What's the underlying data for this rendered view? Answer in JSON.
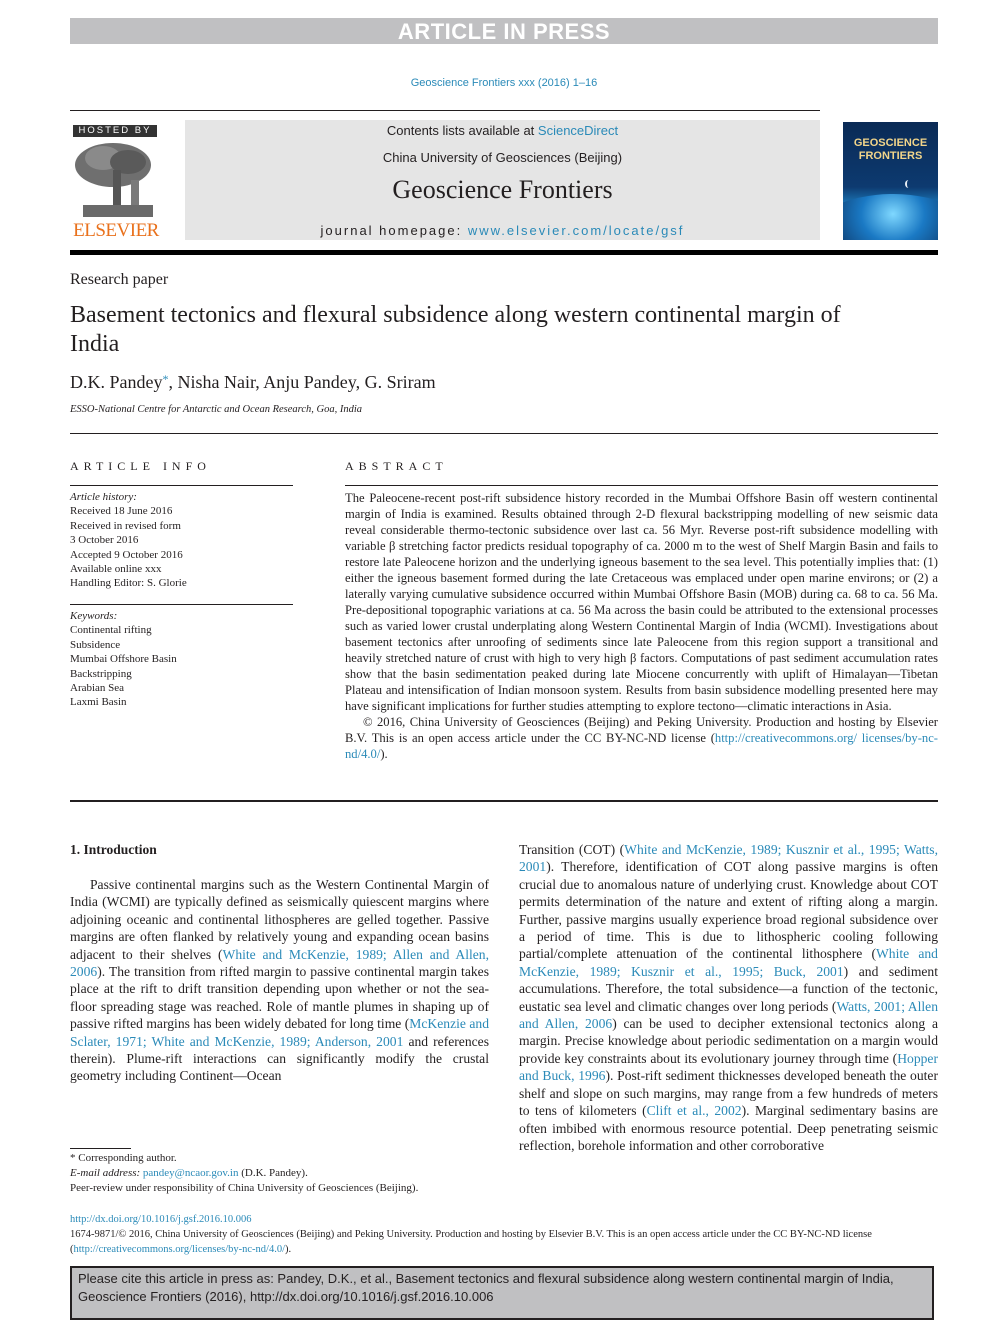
{
  "banner": {
    "text": "ARTICLE IN PRESS"
  },
  "journal_ref": "Geoscience Frontiers xxx (2016) 1–16",
  "publisher": {
    "hosted_by": "HOSTED BY",
    "logo_name": "ELSEVIER"
  },
  "masthead": {
    "contents_prefix": "Contents lists available at ",
    "contents_link": "ScienceDirect",
    "institution": "China University of Geosciences (Beijing)",
    "journal_title": "Geoscience Frontiers",
    "homepage_prefix": "journal homepage: ",
    "homepage_link": "www.elsevier.com/locate/gsf"
  },
  "cover": {
    "title_line1": "GEOSCIENCE",
    "title_line2": "FRONTIERS"
  },
  "article": {
    "type": "Research paper",
    "title": "Basement tectonics and flexural subsidence along western continental margin of India",
    "authors": [
      {
        "name": "D.K. Pandey",
        "mark": "*"
      },
      {
        "name": ", Nisha Nair, Anju Pandey, G. Sriram"
      }
    ],
    "affiliation": "ESSO-National Centre for Antarctic and Ocean Research, Goa, India"
  },
  "article_info": {
    "heading": "ARTICLE INFO",
    "history_label": "Article history:",
    "history": [
      "Received 18 June 2016",
      "Received in revised form",
      "3 October 2016",
      "Accepted 9 October 2016",
      "Available online xxx",
      "Handling Editor: S. Glorie"
    ],
    "keywords_label": "Keywords:",
    "keywords": [
      "Continental rifting",
      "Subsidence",
      "Mumbai Offshore Basin",
      "Backstripping",
      "Arabian Sea",
      "Laxmi Basin"
    ]
  },
  "abstract": {
    "heading": "ABSTRACT",
    "body": "The Paleocene-recent post-rift subsidence history recorded in the Mumbai Offshore Basin off western continental margin of India is examined. Results obtained through 2-D flexural backstripping modelling of new seismic data reveal considerable thermo-tectonic subsidence over last ca. 56 Myr. Reverse post-rift subsidence modelling with variable β stretching factor predicts residual topography of ca. 2000 m to the west of Shelf Margin Basin and fails to restore late Paleocene horizon and the underlying igneous basement to the sea level. This potentially implies that: (1) either the igneous basement formed during the late Cretaceous was emplaced under open marine environs; or (2) a laterally varying cumulative subsidence occurred within Mumbai Offshore Basin (MOB) during ca. 68 to ca. 56 Ma. Pre-depositional topographic variations at ca. 56 Ma across the basin could be attributed to the extensional processes such as varied lower crustal underplating along Western Continental Margin of India (WCMI). Investigations about basement tectonics after unroofing of sediments since late Paleocene from this region support a transitional and heavily stretched nature of crust with high to very high β factors. Computations of past sediment accumulation rates show that the basin sedimentation peaked during late Miocene concurrently with uplift of Himalayan—Tibetan Plateau and intensification of Indian monsoon system. Results from basin subsidence modelling presented here may have significant implications for further studies attempting to explore tectono—climatic interactions in Asia.",
    "copyright_text": "© 2016, China University of Geosciences (Beijing) and Peking University. Production and hosting by Elsevier B.V. This is an open access article under the CC BY-NC-ND license (",
    "license_link_1": "http://creativecommons.org/",
    "license_link_2": "licenses/by-nc-nd/4.0/",
    "copyright_end": ")."
  },
  "introduction": {
    "heading": "1.  Introduction",
    "left": [
      {
        "t": "Passive continental margins such as the Western Continental Margin of India (WCMI) are typically defined as seismically quiescent margins where adjoining oceanic and continental lithospheres are gelled together. Passive margins are often flanked by relatively young and expanding ocean basins adjacent to their shelves ("
      },
      {
        "l": "White and McKenzie, 1989; Allen and Allen, 2006"
      },
      {
        "t": "). The transition from rifted margin to passive continental margin takes place at the rift to drift transition depending upon whether or not the sea-floor spreading stage was reached. Role of mantle plumes in shaping up of passive rifted margins has been widely debated for long time ("
      },
      {
        "l": "McKenzie and Sclater, 1971; White and McKenzie, 1989; Anderson, 2001"
      },
      {
        "t": " and references therein). Plume-rift interactions can significantly modify the crustal geometry including Continent—Ocean"
      }
    ],
    "right": [
      {
        "t": "Transition (COT) ("
      },
      {
        "l": "White and McKenzie, 1989; Kusznir et al., 1995; Watts, 2001"
      },
      {
        "t": "). Therefore, identification of COT along passive margins is often crucial due to anomalous nature of underlying crust. Knowledge about COT permits determination of the nature and extent of rifting along a margin. Further, passive margins usually experience broad regional subsidence over a period of time. This is due to lithospheric cooling following partial/complete attenuation of the continental lithosphere ("
      },
      {
        "l": "White and McKenzie, 1989; Kusznir et al., 1995; Buck, 2001"
      },
      {
        "t": ") and sediment accumulations. Therefore, the total subsidence—a function of the tectonic, eustatic sea level and climatic changes over long periods ("
      },
      {
        "l": "Watts, 2001; Allen and Allen, 2006"
      },
      {
        "t": ") can be used to decipher extensional tectonics along a margin. Precise knowledge about periodic sedimentation on a margin would provide key constraints about its evolutionary journey through time ("
      },
      {
        "l": "Hopper and Buck, 1996"
      },
      {
        "t": "). Post-rift sediment thicknesses developed beneath the outer shelf and slope on such margins, may range from a few hundreds of meters to tens of kilometers ("
      },
      {
        "l": "Clift et al., 2002"
      },
      {
        "t": "). Marginal sedimentary basins are often imbibed with enormous resource potential. Deep penetrating seismic reflection, borehole information and other corroborative"
      }
    ]
  },
  "footnotes": {
    "corresponding": "* Corresponding author.",
    "email_label": "E-mail address: ",
    "email": "pandey@ncaor.gov.in",
    "email_suffix": " (D.K. Pandey).",
    "peer_review": "Peer-review under responsibility of China University of Geosciences (Beijing)."
  },
  "doi_block": {
    "doi_link": "http://dx.doi.org/10.1016/j.gsf.2016.10.006",
    "license_text": "1674-9871/© 2016, China University of Geosciences (Beijing) and Peking University. Production and hosting by Elsevier B.V. This is an open access article under the CC BY-NC-ND license (",
    "license_link": "http://creativecommons.org/licenses/by-nc-nd/4.0/",
    "license_end": ")."
  },
  "cite_box": {
    "line1": "Please cite this article in press as: Pandey, D.K., et al., Basement tectonics and flexural subsidence along western continental margin of India,",
    "line2": "Geoscience Frontiers (2016), http://dx.doi.org/10.1016/j.gsf.2016.10.006"
  },
  "colors": {
    "link": "#2a8ab8",
    "banner_bg": "#c0c0c2",
    "masthead_bg": "#e5e5e5",
    "elsevier_orange": "#e9711c"
  }
}
